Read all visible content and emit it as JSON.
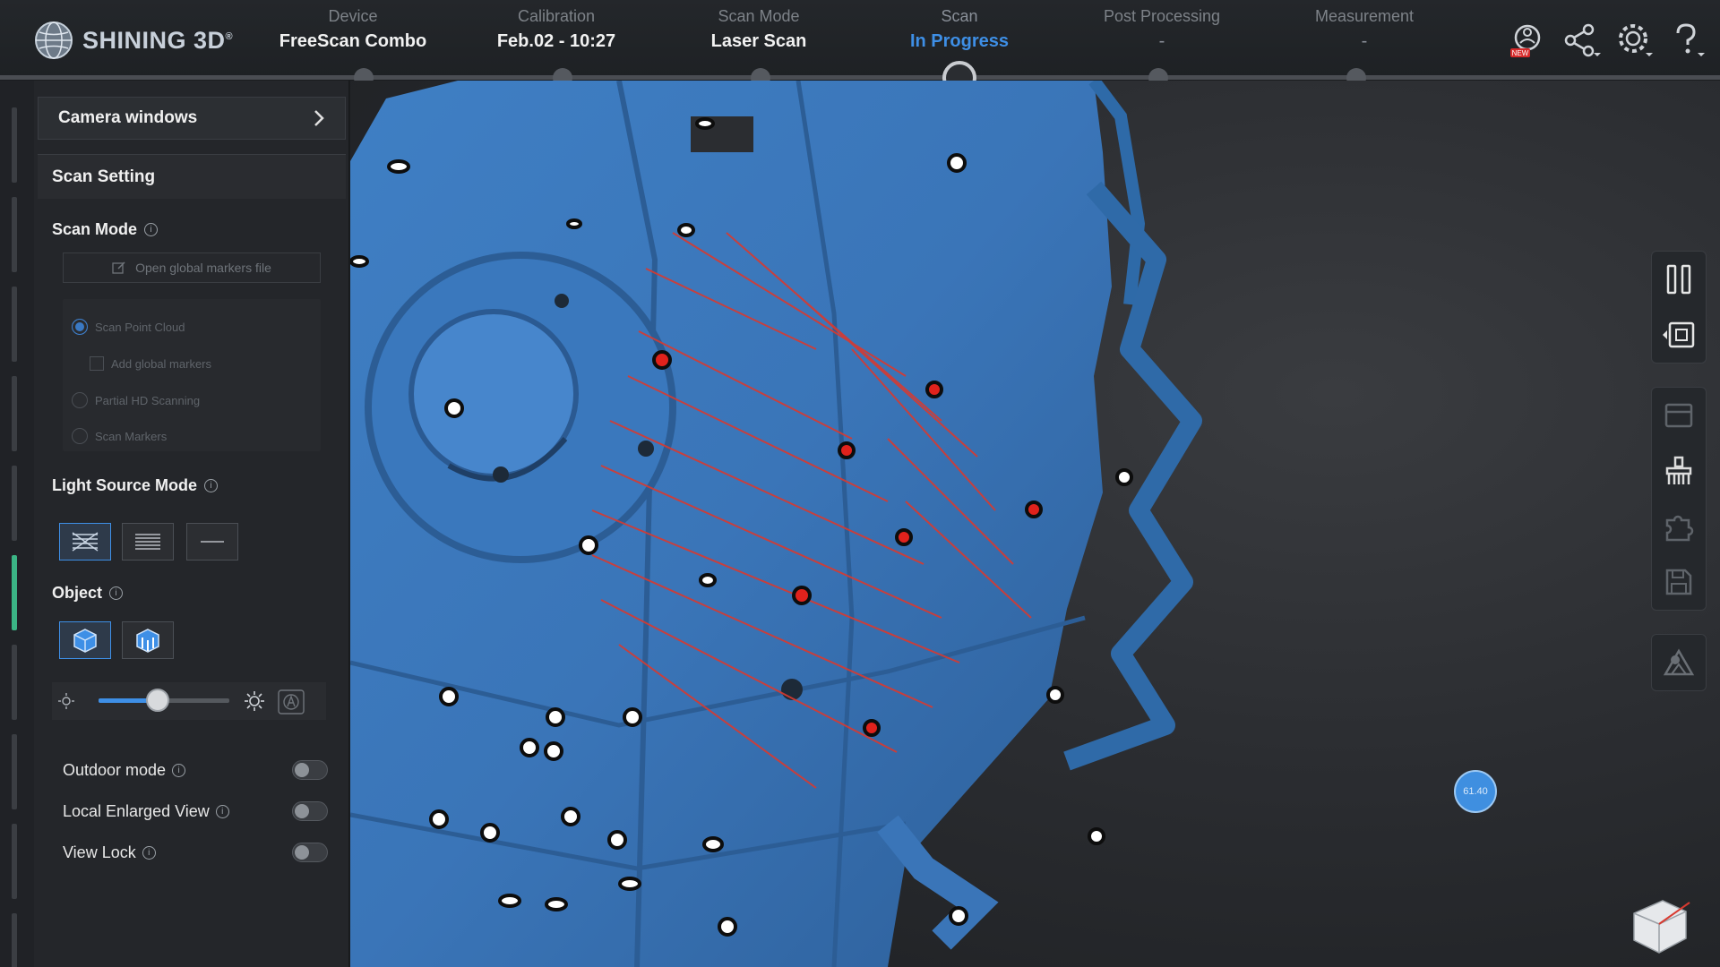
{
  "app": {
    "brand": "SHINING 3D",
    "brand_mark": "®"
  },
  "workflow": {
    "steps": [
      {
        "label": "Device",
        "value": "FreeScan Combo",
        "state": "done"
      },
      {
        "label": "Calibration",
        "value": "Feb.02 - 10:27",
        "state": "done"
      },
      {
        "label": "Scan Mode",
        "value": "Laser Scan",
        "state": "done"
      },
      {
        "label": "Scan",
        "value": "In Progress",
        "state": "active"
      },
      {
        "label": "Post Processing",
        "value": "-",
        "state": "future"
      },
      {
        "label": "Measurement",
        "value": "-",
        "state": "future"
      }
    ]
  },
  "top_icons": [
    {
      "name": "new-feature-icon",
      "badge": "NEW"
    },
    {
      "name": "share-icon"
    },
    {
      "name": "settings-icon"
    },
    {
      "name": "help-icon"
    }
  ],
  "panel": {
    "camera_windows": "Camera windows",
    "scan_setting": "Scan Setting",
    "scan_mode_title": "Scan Mode",
    "open_markers": "Open global markers file",
    "modes": {
      "scan_point_cloud": "Scan Point Cloud",
      "add_global_markers": "Add global markers",
      "partial_hd": "Partial HD Scanning",
      "scan_markers": "Scan Markers"
    },
    "light_source_title": "Light Source Mode",
    "object_title": "Object",
    "brightness_level": 0.45,
    "outdoor_mode": "Outdoor mode",
    "local_enlarged": "Local Enlarged View",
    "view_lock": "View Lock"
  },
  "viewport": {
    "fps": "61.40"
  },
  "colors": {
    "accent": "#3e8fe6",
    "scan": "#3a75b8",
    "laser": "#e03a2e",
    "status_ok": "#3bb585"
  }
}
